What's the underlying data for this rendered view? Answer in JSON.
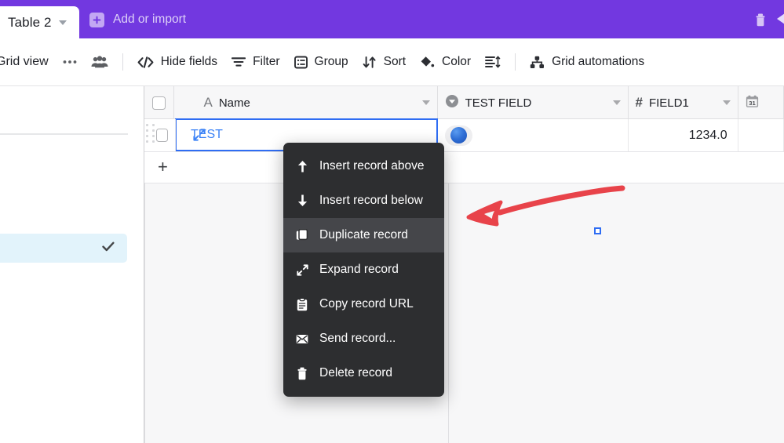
{
  "topbar": {
    "background_color": "#7238E0",
    "tab": {
      "label": "Table 2",
      "caret_icon": "chevron-down-icon"
    },
    "add_or_import": {
      "label": "Add or import",
      "icon": "plus-square-icon"
    },
    "trash_icon": "trash-icon",
    "edge_icon": "chevron-left-icon"
  },
  "toolbar": {
    "view_name": "Grid view",
    "more_icon": "ellipsis-icon",
    "collaborators_icon": "people-icon",
    "items": [
      {
        "label": "Hide fields",
        "icon": "code-slash-icon"
      },
      {
        "label": "Filter",
        "icon": "filter-icon"
      },
      {
        "label": "Group",
        "icon": "group-icon"
      },
      {
        "label": "Sort",
        "icon": "sort-icon"
      },
      {
        "label": "Color",
        "icon": "paint-bucket-icon"
      }
    ],
    "row_height_icon": "row-height-icon",
    "automations": {
      "label": "Grid automations",
      "icon": "automation-icon"
    }
  },
  "sidebar": {
    "selected_item": {
      "label": "",
      "check_icon": "check-icon"
    }
  },
  "grid": {
    "columns": [
      {
        "key": "check",
        "label": "",
        "icon": "checkbox-icon"
      },
      {
        "key": "name",
        "label": "Name",
        "icon": "text-field-icon",
        "icon_glyph": "A"
      },
      {
        "key": "test_field",
        "label": "TEST FIELD",
        "icon": "single-select-icon"
      },
      {
        "key": "field1",
        "label": "FIELD1",
        "icon": "number-field-icon",
        "icon_glyph": "#"
      },
      {
        "key": "date",
        "label": "",
        "icon": "calendar-icon",
        "icon_glyph": "31"
      }
    ],
    "rows": [
      {
        "expand_icon": "expand-record-icon",
        "name": "TEST",
        "test_field": {
          "type": "select-pill",
          "color": "#2f6fd6",
          "label": ""
        },
        "field1": "1234.0"
      }
    ],
    "add_row": {
      "label": "+",
      "icon": "plus-icon"
    },
    "selected_cell": {
      "column": "name",
      "value": "TEST",
      "border_color": "#2f6df3"
    }
  },
  "context_menu": {
    "items": [
      {
        "label": "Insert record above",
        "icon": "arrow-up-icon",
        "active": false
      },
      {
        "label": "Insert record below",
        "icon": "arrow-down-icon",
        "active": false
      },
      {
        "label": "Duplicate record",
        "icon": "duplicate-icon",
        "active": true
      },
      {
        "label": "Expand record",
        "icon": "expand-icon",
        "active": false
      },
      {
        "label": "Copy record URL",
        "icon": "clipboard-icon",
        "active": false
      },
      {
        "label": "Send record...",
        "icon": "envelope-icon",
        "active": false
      },
      {
        "label": "Delete record",
        "icon": "trash-icon",
        "active": false
      }
    ],
    "background_color": "#2d2e30",
    "active_color": "#45464a"
  },
  "annotation": {
    "type": "hand-drawn-arrow",
    "color": "#e8434a",
    "direction": "left"
  }
}
